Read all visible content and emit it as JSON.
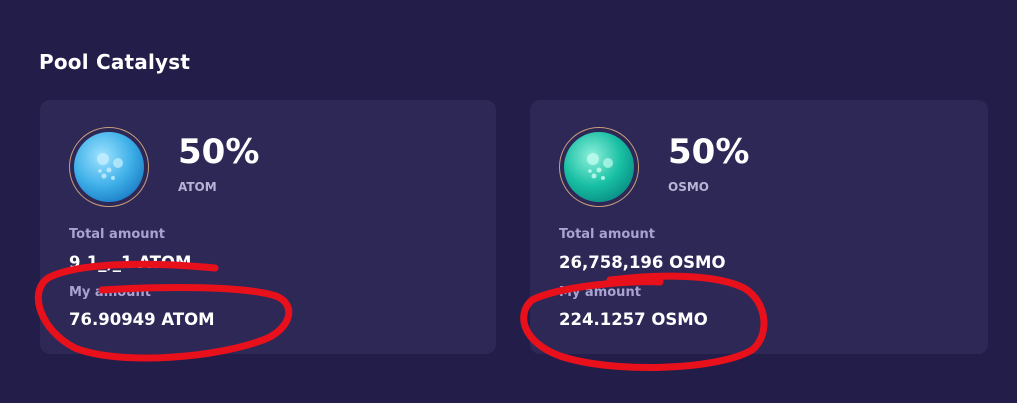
{
  "page": {
    "title": "Pool Catalyst"
  },
  "cards": [
    {
      "percent": "50%",
      "symbol": "ATOM",
      "total_label": "Total amount",
      "total_value": "9,1_,_1 ATOM",
      "my_label": "My amount",
      "my_value": "76.90949 ATOM",
      "logo_color": "#3fb0e8"
    },
    {
      "percent": "50%",
      "symbol": "OSMO",
      "total_label": "Total amount",
      "total_value": "26,758,196 OSMO",
      "my_label": "My amount",
      "my_value": "224.1257 OSMO",
      "logo_color": "#18bfa3"
    }
  ],
  "annotation": {
    "color": "#e8111b"
  }
}
